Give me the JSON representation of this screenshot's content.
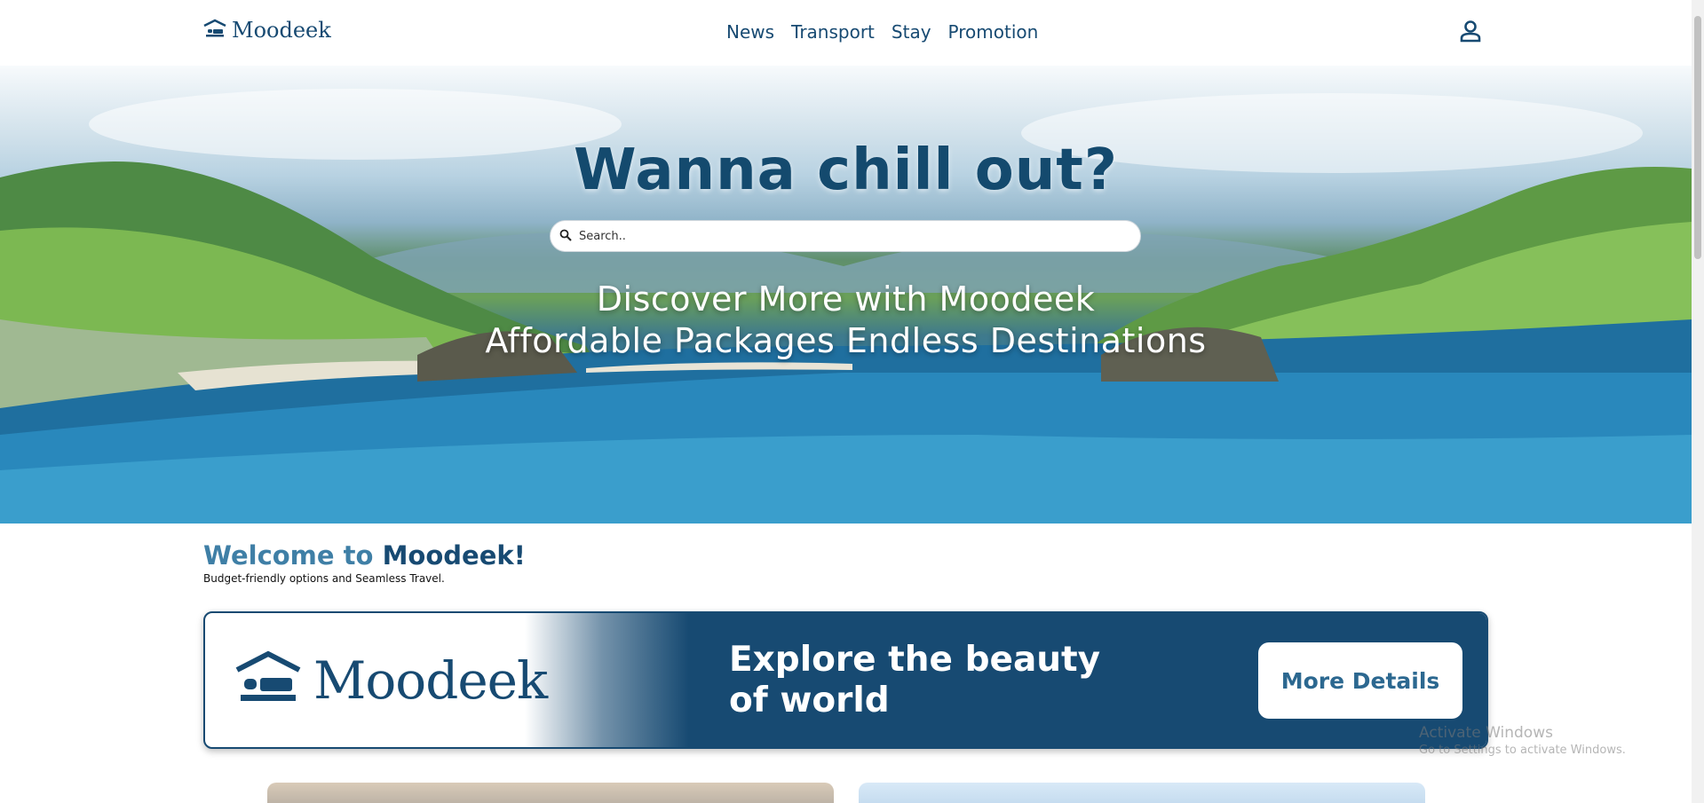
{
  "header": {
    "brand": "Moodeek",
    "nav": [
      {
        "label": "News"
      },
      {
        "label": "Transport"
      },
      {
        "label": "Stay"
      },
      {
        "label": "Promotion"
      }
    ],
    "user_icon": "user-icon"
  },
  "hero": {
    "title": "Wanna chill out?",
    "search": {
      "placeholder": "Search..",
      "value": "",
      "icon": "search-icon"
    },
    "subtitle_line1": "Discover More with Moodeek",
    "subtitle_line2": "Affordable Packages Endless Destinations"
  },
  "welcome": {
    "title_part1": "Welcome to",
    "title_part2": "Moodeek!",
    "subtitle": "Budget-friendly options and Seamless Travel."
  },
  "banner": {
    "brand": "Moodeek",
    "headline_line1": "Explore the beauty",
    "headline_line2": "of world",
    "button_label": "More Details"
  },
  "watermark": {
    "line1": "Activate Windows",
    "line2": "Go to Settings to activate Windows."
  },
  "colors": {
    "primary": "#174a72",
    "accent": "#3f7fa6",
    "white": "#ffffff"
  }
}
